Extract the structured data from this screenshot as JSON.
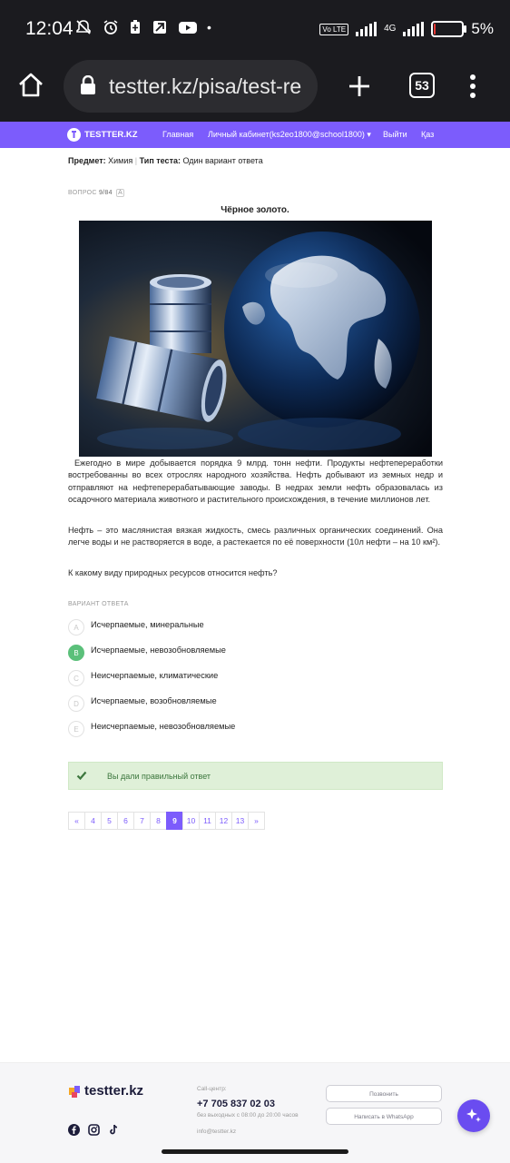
{
  "status_bar": {
    "time": "12:04",
    "volte": "Vo LTE",
    "network": "4G",
    "battery_percent": "5%",
    "battery_level": 0.05,
    "battery_color": "#e53935"
  },
  "browser": {
    "url": "testter.kz/pisa/test-re",
    "tab_count": "53",
    "icons": [
      "home-icon",
      "lock-icon",
      "plus-icon",
      "tabs-icon",
      "kebab-menu-icon"
    ]
  },
  "nav": {
    "brand": "TESTTER.KZ",
    "items": [
      "Главная",
      "Личный кабинет(ks2eo1800@school1800) ▾",
      "Выйти",
      "Қаз"
    ],
    "accent_color": "#7c5cfc"
  },
  "meta": {
    "subject_label": "Предмет:",
    "subject_value": "Химия",
    "type_label": "Тип теста:",
    "type_value": "Один вариант ответа"
  },
  "question": {
    "counter_prefix": "ВОПРОС",
    "counter": "9/84",
    "report_icon": "A",
    "title": "Чёрное золото.",
    "paragraph1": "Ежегодно в мире добывается порядка 9 млрд. тонн нефти. Продукты нефтепереработки востребованны во всех отрослях народного хозяйства. Нефть добывают из земных недр и отправляют на нефтеперерабатывающие заводы. В недрах земли нефть образовалась из осадочного материала животного и растительного происхождения, в течение миллионов лет.",
    "paragraph2": "Нефть – это маслянистая вязкая жидкость, смесь различных органических соединений. Она легче воды и не растворяется в воде, а растекается по её поверхности (10л нефти – на 10 км²).",
    "prompt": "К какому виду природных ресурсов относится нефть?"
  },
  "answers": {
    "label": "ВАРИАНТ ОТВЕТА",
    "options": [
      {
        "letter": "A",
        "text": "Исчерпаемые, минеральные",
        "correct": false
      },
      {
        "letter": "B",
        "text": "Исчерпаемые, невозобновляемые",
        "correct": true
      },
      {
        "letter": "C",
        "text": "Неисчерпаемые, климатические",
        "correct": false
      },
      {
        "letter": "D",
        "text": "Исчерпаемые, возобновляемые",
        "correct": false
      },
      {
        "letter": "E",
        "text": "Неисчерпаемые, невозобновляемые",
        "correct": false
      }
    ],
    "correct_color": "#5bc07a"
  },
  "result": {
    "icon": "check-icon",
    "text": "Вы дали правильный ответ"
  },
  "pagination": {
    "prev": "«",
    "pages": [
      "4",
      "5",
      "6",
      "7",
      "8",
      "9",
      "10",
      "11",
      "12",
      "13"
    ],
    "active": "9",
    "next": "»"
  },
  "footer": {
    "logo_text": "testter.kz",
    "call_center_label": "Call-центр:",
    "phone": "+7 705 837 02 03",
    "hours": "без выходных с 08:00 до 20:00 часов",
    "email": "info@testter.kz",
    "call_button": "Позвонить",
    "whatsapp_button": "Написать в WhatsApp",
    "socials": [
      "facebook-icon",
      "instagram-icon",
      "tiktok-icon"
    ]
  }
}
